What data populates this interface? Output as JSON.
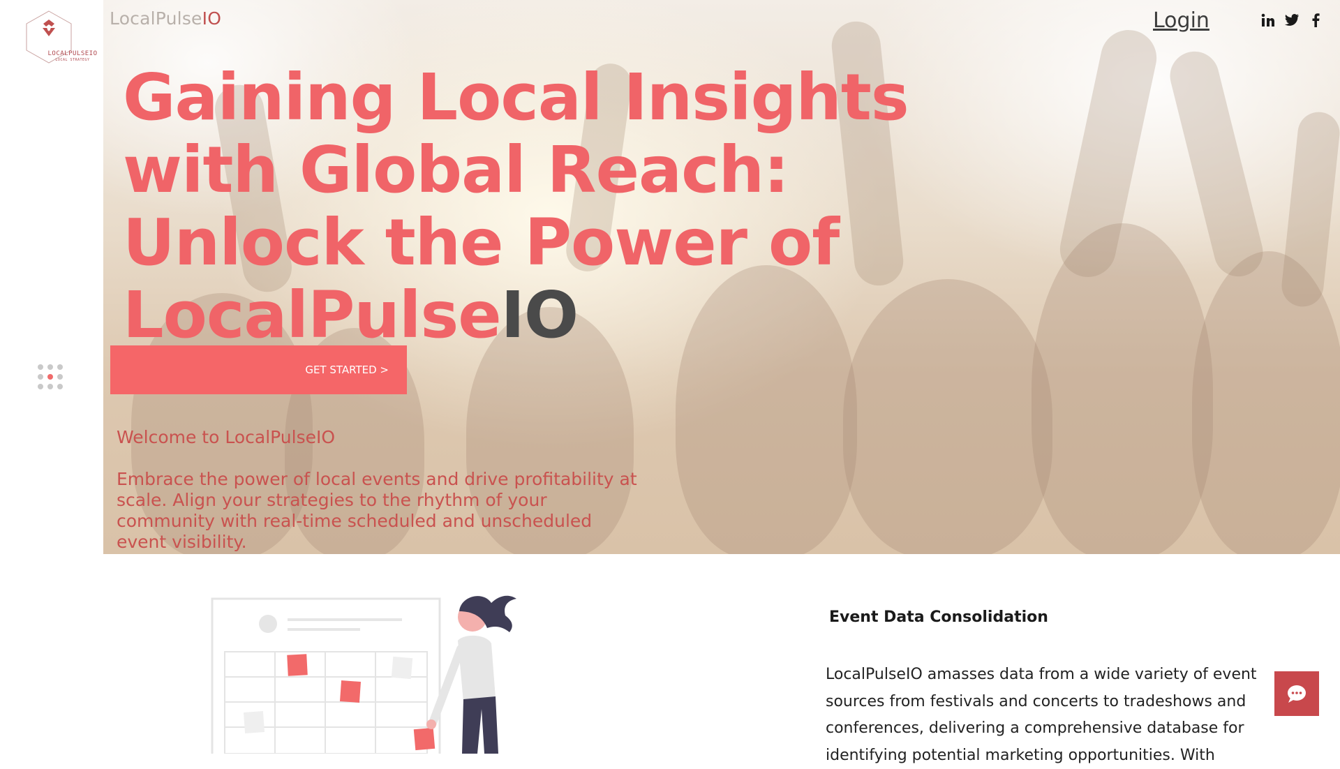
{
  "brand": {
    "name_main": "LocalPulse",
    "name_suffix": "IO"
  },
  "logo": {
    "text": "LOCALPULSEIO",
    "subtext": "LOCAL STRATEGY"
  },
  "header": {
    "login_label": "Login"
  },
  "social_icons": [
    "linkedin-icon",
    "twitter-icon",
    "facebook-icon"
  ],
  "hero": {
    "headline_main": "Gaining Local Insights with Global Reach: Unlock the Power of LocalPulse",
    "headline_suffix": "IO",
    "cta_label": "GET STARTED >",
    "welcome": "Welcome to LocalPulseIO",
    "intro": "Embrace the power of local events and drive profitability at scale. Align your strategies to the rhythm of your community with real-time scheduled and unscheduled event visibility."
  },
  "feature": {
    "title": "Event Data Consolidation",
    "body": " LocalPulseIO amasses data from a wide variety of event sources from festivals and concerts to tradeshows and conferences, delivering a comprehensive database for identifying potential marketing opportunities. With"
  },
  "colors": {
    "accent": "#f56668",
    "headline": "#f06468",
    "dark": "#4a4a4a",
    "chat": "#c8484c"
  },
  "chat": {
    "icon": "chat-bubble-icon"
  }
}
